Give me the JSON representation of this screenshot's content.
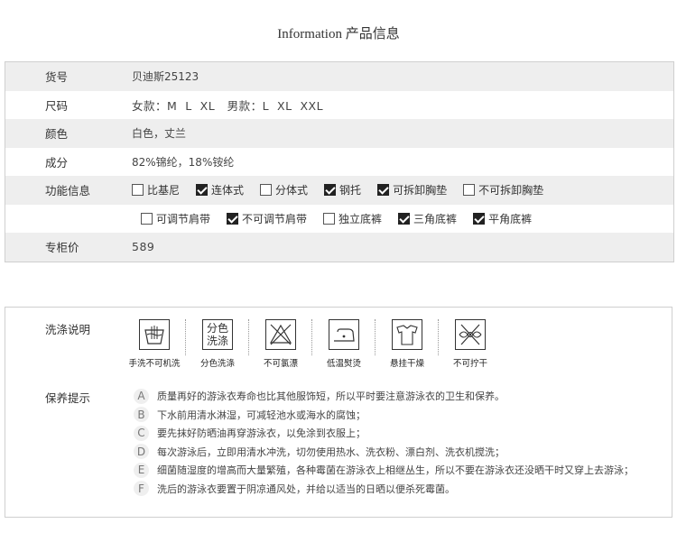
{
  "title": "Information 产品信息",
  "spec": {
    "sku_label": "货号",
    "sku": "贝迪斯25123",
    "size_label": "尺码",
    "size": "女款：M  L  XL   男款：L  XL  XXL",
    "color_label": "颜色",
    "color": "白色，丈兰",
    "material_label": "成分",
    "material": "82%锦纶，18%铵纶",
    "features_label": "功能信息",
    "features_row1": [
      {
        "label": "比基尼",
        "checked": false
      },
      {
        "label": "连体式",
        "checked": true
      },
      {
        "label": "分体式",
        "checked": false
      },
      {
        "label": "钢托",
        "checked": true
      },
      {
        "label": "可拆卸胸垫",
        "checked": true
      },
      {
        "label": "不可拆卸胸垫",
        "checked": false
      }
    ],
    "features_row2": [
      {
        "label": "可调节肩带",
        "checked": false
      },
      {
        "label": "不可调节肩带",
        "checked": true
      },
      {
        "label": "独立底裤",
        "checked": false
      },
      {
        "label": "三角底裤",
        "checked": true
      },
      {
        "label": "平角底裤",
        "checked": true
      }
    ],
    "price_label": "专柜价",
    "price": "589"
  },
  "care": {
    "wash_label": "洗涤说明",
    "icons": [
      {
        "icon": "hand-wash-icon",
        "caption": "手洗不可机洗"
      },
      {
        "icon": "separate-wash-icon",
        "caption": "分色洗涤",
        "text1": "分色",
        "text2": "洗涤"
      },
      {
        "icon": "no-bleach-icon",
        "caption": "不可氯漂"
      },
      {
        "icon": "low-iron-icon",
        "caption": "低温熨烫"
      },
      {
        "icon": "hang-dry-icon",
        "caption": "悬挂干燥"
      },
      {
        "icon": "no-wring-icon",
        "caption": "不可拧干"
      }
    ],
    "tips_label": "保养提示",
    "tips": [
      {
        "letter": "A",
        "text": "质量再好的游泳衣寿命也比其他服饰短，所以平时要注意游泳衣的卫生和保养。"
      },
      {
        "letter": "B",
        "text": "下水前用清水淋湿，可减轻池水或海水的腐蚀；"
      },
      {
        "letter": "C",
        "text": "要先抹好防晒油再穿游泳衣，以免涂到衣服上；"
      },
      {
        "letter": "D",
        "text": "每次游泳后，立即用清水冲洗，切勿使用热水、洗衣粉、漂白剂、洗衣机搅洗；"
      },
      {
        "letter": "E",
        "text": "细菌随湿度的增高而大量繁殖，各种霉菌在游泳衣上相继丛生，所以不要在游泳衣还没晒干时又穿上去游泳；"
      },
      {
        "letter": "F",
        "text": "洗后的游泳衣要置于阴凉通风处，并给以适当的日晒以便杀死霉菌。"
      }
    ]
  }
}
